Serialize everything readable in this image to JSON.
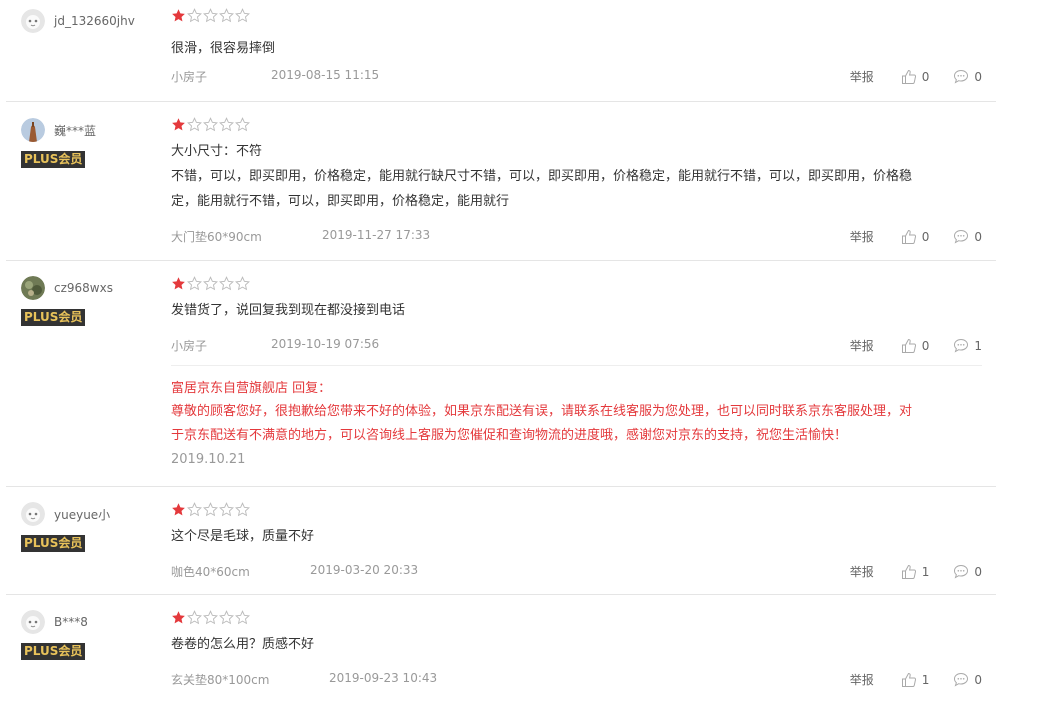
{
  "actions": {
    "report_label": "举报"
  },
  "reviews": [
    {
      "user": "jd_132660jhv",
      "plus": "",
      "rating": 1,
      "lines": [
        "很滑，很容易摔倒"
      ],
      "spec": "小房子",
      "date": "2019-08-15 11:15",
      "likes": "0",
      "comments": "0"
    },
    {
      "user": "巍***蓝",
      "plus": "PLUS会员",
      "rating": 1,
      "lines": [
        "大小尺寸：不符",
        "不错，可以，即买即用，价格稳定，能用就行缺尺寸不错，可以，即买即用，价格稳定，能用就行不错，可以，即买即用，价格稳",
        "定，能用就行不错，可以，即买即用，价格稳定，能用就行"
      ],
      "spec": "大门垫60*90cm",
      "date": "2019-11-27 17:33",
      "likes": "0",
      "comments": "0"
    },
    {
      "user": "cz968wxs",
      "plus": "PLUS会员",
      "rating": 1,
      "lines": [
        "发错货了，说回复我到现在都没接到电话"
      ],
      "spec": "小房子",
      "date": "2019-10-19 07:56",
      "likes": "0",
      "comments": "1",
      "reply": {
        "header": "富居京东自营旗舰店 回复：",
        "lines": [
          "尊敬的顾客您好，很抱歉给您带来不好的体验，如果京东配送有误，请联系在线客服为您处理，也可以同时联系京东客服处理，对",
          "于京东配送有不满意的地方，可以咨询线上客服为您催促和查询物流的进度哦，感谢您对京东的支持，祝您生活愉快！"
        ],
        "date": "2019.10.21"
      }
    },
    {
      "user": "yueyue小",
      "plus": "PLUS会员",
      "rating": 1,
      "lines": [
        "这个尽是毛球，质量不好"
      ],
      "spec": "咖色40*60cm",
      "date": "2019-03-20 20:33",
      "likes": "1",
      "comments": "0"
    },
    {
      "user": "B***8",
      "plus": "PLUS会员",
      "rating": 1,
      "lines": [
        "卷卷的怎么用？质感不好"
      ],
      "spec": "玄关垫80*100cm",
      "date": "2019-09-23 10:43",
      "likes": "1",
      "comments": "0"
    }
  ],
  "colors": {
    "star_filled": "#e4393c",
    "plus_bg": "#333333",
    "plus_text": "#e8c25a",
    "reply_text": "#e4393c"
  },
  "icons": {
    "star": "star-icon",
    "like": "thumbs-up-icon",
    "comment": "comment-bubble-icon"
  }
}
